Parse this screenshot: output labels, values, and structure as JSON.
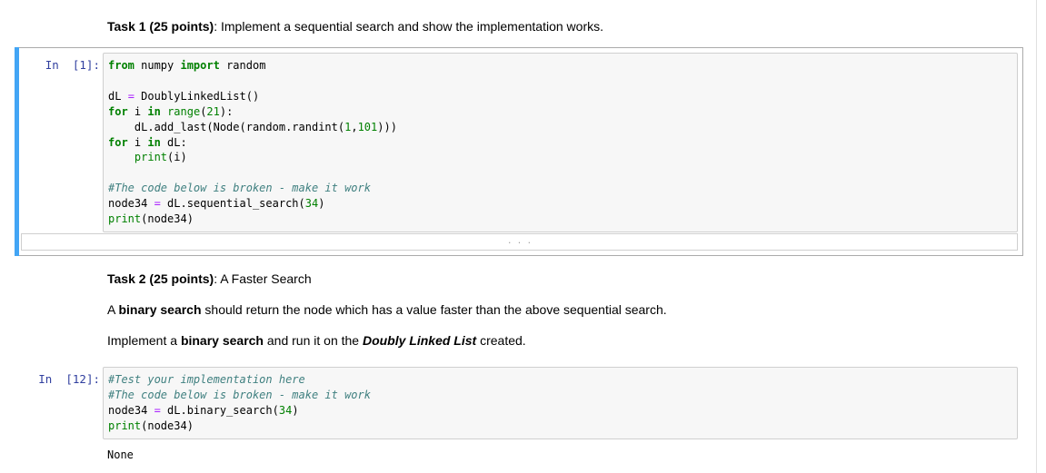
{
  "task1": {
    "heading_bold": "Task 1 (25 points)",
    "heading_rest": ": Implement a sequential search and show the implementation works."
  },
  "cell1": {
    "prompt": "In  [1]:",
    "code": {
      "l1_kw1": "from",
      "l1_mod": " numpy ",
      "l1_kw2": "import",
      "l1_rest": " random",
      "l3_var": "dL ",
      "l3_op": "=",
      "l3_rest": " DoublyLinkedList()",
      "l4_kw1": "for",
      "l4_var": " i ",
      "l4_kw2": "in",
      "l4_sp": " ",
      "l4_bt": "range",
      "l4_p1": "(",
      "l4_num": "21",
      "l4_p2": "):",
      "l5_pre": "    dL.add_last(Node(random.randint(",
      "l5_n1": "1",
      "l5_c": ",",
      "l5_n2": "101",
      "l5_post": ")))",
      "l6_kw1": "for",
      "l6_var": " i ",
      "l6_kw2": "in",
      "l6_rest": " dL:",
      "l7_ind": "    ",
      "l7_bt": "print",
      "l7_rest": "(i)",
      "l9_cm": "#The code below is broken - make it work",
      "l10_var": "node34 ",
      "l10_op": "=",
      "l10_pre": " dL.sequential_search(",
      "l10_num": "34",
      "l10_post": ")",
      "l11_bt": "print",
      "l11_rest": "(node34)"
    },
    "collapsed_indicator": ". . ."
  },
  "task2": {
    "heading_bold": "Task 2 (25 points)",
    "heading_rest": ": A Faster Search",
    "p1_pre": "A ",
    "p1_bold": "binary search",
    "p1_post": " should return the node which has a value faster than the above sequential search.",
    "p2_pre": "Implement a ",
    "p2_bold": "binary search",
    "p2_mid": " and run it on the ",
    "p2_bi": "Doubly Linked List",
    "p2_post": " created."
  },
  "cell2": {
    "prompt": "In  [12]:",
    "code": {
      "l1_cm": "#Test your implementation here",
      "l2_cm": "#The code below is broken - make it work",
      "l3_var": "node34 ",
      "l3_op": "=",
      "l3_pre": " dL.binary_search(",
      "l3_num": "34",
      "l3_post": ")",
      "l4_bt": "print",
      "l4_rest": "(node34)"
    },
    "output": "None"
  }
}
